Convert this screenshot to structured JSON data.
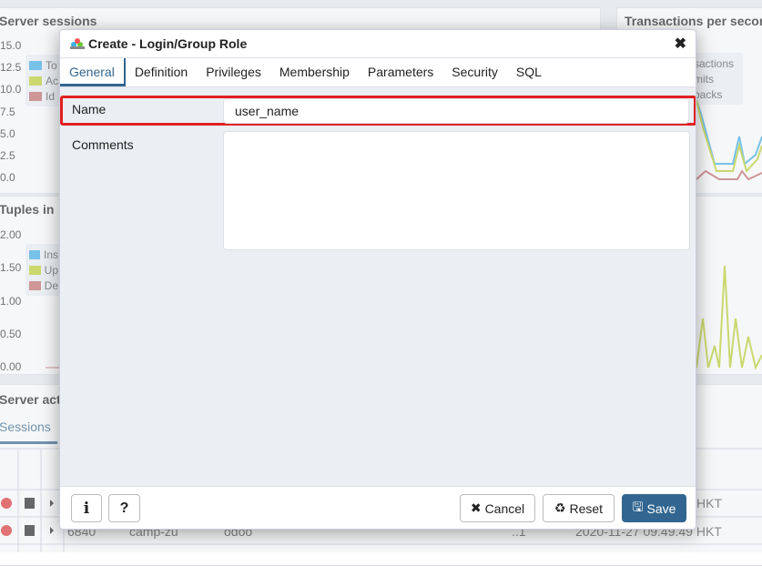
{
  "background": {
    "sessions_panel": {
      "title": "Server sessions",
      "ticks": [
        "15.0",
        "12.5",
        "10.0",
        "7.5",
        "5.0",
        "2.5",
        "0.0"
      ],
      "legend": [
        "To",
        "Ac",
        "Id"
      ]
    },
    "tuples_panel": {
      "title": "Tuples in",
      "ticks": [
        "2.00",
        "1.50",
        "1.00",
        "0.50",
        "0.00"
      ],
      "legend": [
        "Ins",
        "Up",
        "De"
      ]
    },
    "tps_panel": {
      "title": "Transactions per second",
      "legend": [
        "sactions",
        "mits",
        "backs"
      ]
    },
    "activity": {
      "title": "Server acti",
      "tab": "Sessions",
      "rows": [
        [
          "",
          "",
          "",
          "",
          "HKT"
        ],
        [
          "6840",
          "camp-zu",
          "odoo",
          "..1",
          "2020-11-27 09.49.49 HKT"
        ]
      ]
    },
    "colors": {
      "blue": "#3daee9",
      "green": "#bccf2b",
      "red": "#c26a6a"
    }
  },
  "dialog": {
    "title": "Create - Login/Group Role",
    "close": "✖",
    "tabs": [
      "General",
      "Definition",
      "Privileges",
      "Membership",
      "Parameters",
      "Security",
      "SQL"
    ],
    "active_tab": "General",
    "name_label": "Name",
    "name_value": "user_name",
    "comments_label": "Comments",
    "comments_value": "",
    "info_label": "i",
    "help_label": "?",
    "cancel_label": "Cancel",
    "reset_label": "Reset",
    "save_label": "Save",
    "accent": "#326690",
    "highlight": "#e02020"
  }
}
